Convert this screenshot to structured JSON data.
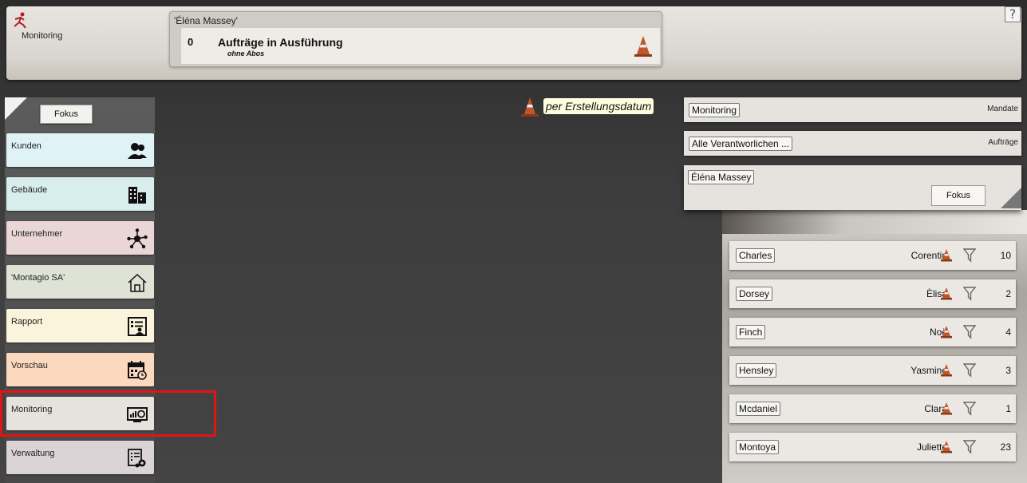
{
  "header": {
    "app_title": "Monitoring",
    "help": "?",
    "user": "'Éléna Massey'",
    "jobs_count": "0",
    "jobs_title": "Aufträge in Ausführung",
    "jobs_sub": "ohne Abos"
  },
  "sidebar": {
    "fokus": "Fokus",
    "items": [
      {
        "label": "Kunden",
        "icon": "customers-icon",
        "color": "#dff2f6"
      },
      {
        "label": "Gebäude",
        "icon": "building-icon",
        "color": "#d8eeec"
      },
      {
        "label": "Unternehmer",
        "icon": "network-icon",
        "color": "#ead6d6"
      },
      {
        "label": "'Montagio SA'",
        "icon": "home-icon",
        "color": "#dfe3d6"
      },
      {
        "label": "Rapport",
        "icon": "report-icon",
        "color": "#fbf4dc"
      },
      {
        "label": "Vorschau",
        "icon": "calendar-icon",
        "color": "#fbd9bf"
      },
      {
        "label": "Monitoring",
        "icon": "monitor-icon",
        "color": "#e6e3de"
      },
      {
        "label": "Verwaltung",
        "icon": "admin-icon",
        "color": "#dad4d6"
      }
    ]
  },
  "main": {
    "sort_label": "per Erstellungsdatum"
  },
  "right": {
    "filter1": {
      "button": "Monitoring",
      "tag": "Mandate"
    },
    "filter2": {
      "button": "Alle Verantworlichen ...",
      "tag": "Aufträge"
    },
    "focus": {
      "user": "Éléna Massey",
      "fokus": "Fokus"
    },
    "rows": [
      {
        "last": "Charles",
        "first": "Corentin",
        "count": "10"
      },
      {
        "last": "Dorsey",
        "first": "Èlisa",
        "count": "2"
      },
      {
        "last": "Finch",
        "first": "Noë",
        "count": "4"
      },
      {
        "last": "Hensley",
        "first": "Yasmine",
        "count": "3"
      },
      {
        "last": "Mcdaniel",
        "first": "Clara",
        "count": "1"
      },
      {
        "last": "Montoya",
        "first": "Juliette",
        "count": "23"
      }
    ]
  },
  "colors": {
    "highlight": "#e01515",
    "cone": "#c0562a"
  }
}
